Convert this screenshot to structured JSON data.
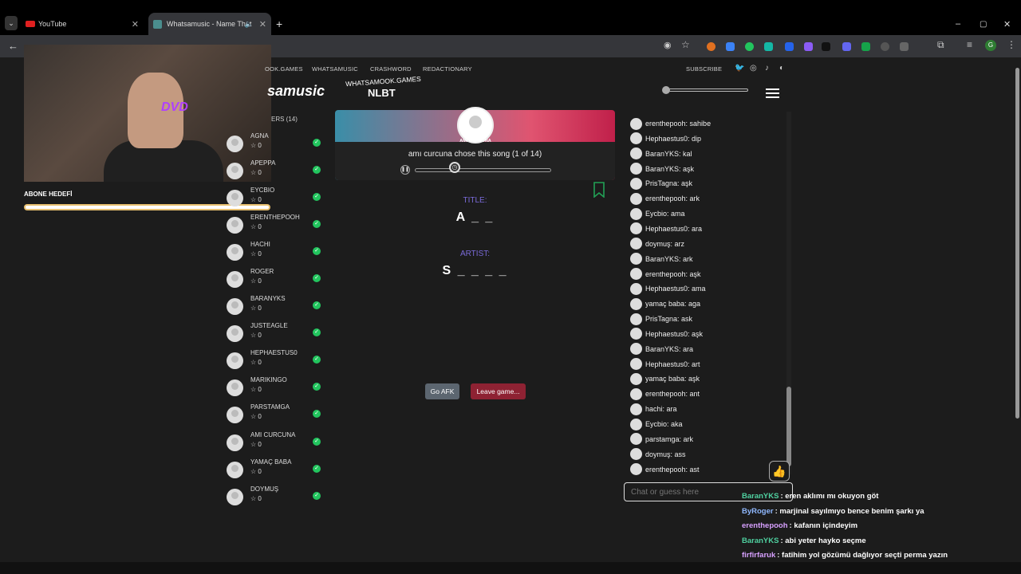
{
  "browser": {
    "tabs": [
      {
        "title": "YouTube",
        "icon": "youtube-icon"
      },
      {
        "title": "Whatsamusic - Name That",
        "icon": "whatsamusic-icon"
      }
    ],
    "new_tab": "+",
    "tab_close": "✕",
    "window": {
      "minimize": "–",
      "maximize": "▢",
      "close": "✕"
    }
  },
  "overlay": {
    "webcam_text": "DVD",
    "goal_label": "ABONE HEDEFİ",
    "goal_progress": 1.0
  },
  "site": {
    "nav": [
      "OOK.GAMES",
      "WHATSAMUSIC",
      "CRASHWORD",
      "REDACTIONARY"
    ],
    "subscribe": "SUBSCRIBE",
    "logo": "samusic",
    "brand_top": "WHATSAMOOK.GAMES",
    "brand_bottom": "NLBT"
  },
  "players_title": "ERS (14)",
  "players": [
    {
      "name": "AGNA",
      "score": "0"
    },
    {
      "name": "APEPPA",
      "score": "0"
    },
    {
      "name": "EYCBIO",
      "score": "0"
    },
    {
      "name": "ERENTHEPOOH",
      "score": "0"
    },
    {
      "name": "HACHI",
      "score": "0"
    },
    {
      "name": "ROGER",
      "score": "0"
    },
    {
      "name": "BARANYKS",
      "score": "0"
    },
    {
      "name": "JUSTEAGLE",
      "score": "0"
    },
    {
      "name": "HEPHAESTUS0",
      "score": "0"
    },
    {
      "name": "MARIKINGO",
      "score": "0"
    },
    {
      "name": "PARSTAMGA",
      "score": "0"
    },
    {
      "name": "AMI CURCUNA",
      "score": "0"
    },
    {
      "name": "YAMAÇ BABA",
      "score": "0"
    },
    {
      "name": "DOYMUŞ",
      "score": "0"
    }
  ],
  "game": {
    "chooser": "AMI CURCUNA",
    "status": "amı curcuna chose this song (1 of 14)",
    "title_label": "TITLE:",
    "title_hint": "A _ _",
    "artist_label": "ARTIST:",
    "artist_hint": "S _ _ _ _",
    "afk_button": "Go AFK",
    "leave_button": "Leave game..."
  },
  "chat": [
    "erenthepooh: sahibe",
    "Hephaestus0: dip",
    "BaranYKS: kal",
    "BaranYKS: aşk",
    "PrisTagna: aşk",
    "erenthepooh: ark",
    "Eycbio: ama",
    "Hephaestus0: ara",
    "doymuş: arz",
    "BaranYKS: ark",
    "erenthepooh: aşk",
    "Hephaestus0: ama",
    "yamaç baba: aga",
    "PrisTagna: ask",
    "Hephaestus0: aşk",
    "BaranYKS: ara",
    "Hephaestus0: art",
    "yamaç baba: aşk",
    "erenthepooh: ant",
    "hachi: ara",
    "Eycbio: aka",
    "parstamga: ark",
    "doymuş: ass",
    "erenthepooh: ast"
  ],
  "chat_input": {
    "placeholder": "Chat or guess here"
  },
  "stream_chat": [
    {
      "user": "BaranYKS",
      "color": "#4fd1a0",
      "text": ": eren aklımı mı okuyon göt"
    },
    {
      "user": "ByRoger",
      "color": "#8fb8ff",
      "text": ": marjinal sayılmıyo bence benim şarkı ya"
    },
    {
      "user": "erenthepooh",
      "color": "#d7a0ff",
      "text": ": kafanın içindeyim"
    },
    {
      "user": "BaranYKS",
      "color": "#4fd1a0",
      "text": ": abi yeter hayko seçme"
    },
    {
      "user": "firfirfaruk",
      "color": "#d7a0ff",
      "text": ": fatihim yol gözümü dağlıyor seçti perma yazın"
    }
  ]
}
